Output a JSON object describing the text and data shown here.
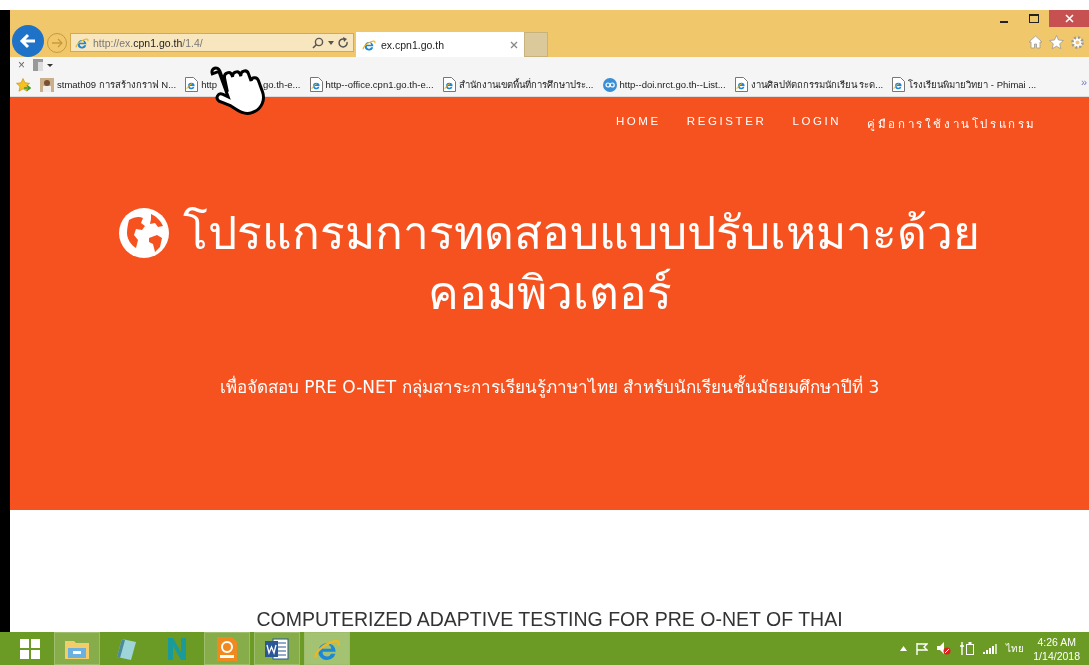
{
  "browser": {
    "command_close": "×",
    "address": "http://ex.**cpn1.go.th**/1.4/",
    "tab_title": "ex.cpn1.go.th",
    "favorites": [
      {
        "kind": "photo",
        "label": "stmath09 การสร้างกราฟ N..."
      },
      {
        "kind": "ie",
        "label": "http",
        "label_end": "go.th-e..."
      },
      {
        "kind": "ie",
        "label": "http--office.cpn1.go.th-e..."
      },
      {
        "kind": "ie",
        "label": "สำนักงานเขตพื้นที่การศึกษาประ..."
      },
      {
        "kind": "doi",
        "label": "http--doi.nrct.go.th--List..."
      },
      {
        "kind": "ie",
        "label": "งานศิลปหัตถกรรมนักเรียน ระด..."
      },
      {
        "kind": "ie",
        "label": "โรงเรียนพิมายวิทยา - Phimai ..."
      }
    ],
    "more": "»"
  },
  "page": {
    "nav": [
      {
        "label": "HOME"
      },
      {
        "label": "REGISTER"
      },
      {
        "label": "LOGIN"
      },
      {
        "label": "คู่มือการใช้งานโปรแกรม"
      }
    ],
    "title_lines": [
      "โปรแกรมการทดสอบแบบปรับเหมาะด้วย",
      "คอมพิวเตอร์"
    ],
    "subtitle": "เพื่อจัดสอบ PRE O-NET กลุ่มสาระการเรียนรู้ภาษาไทย สำหรับนักเรียนชั้นมัธยมศึกษาปีที่ 3",
    "section_heading": "COMPUTERIZED ADAPTIVE TESTING FOR PRE O-NET OF THAI"
  },
  "taskbar": {
    "apps": [
      {
        "kind": "explorer",
        "running": true,
        "selected": false
      },
      {
        "kind": "notepad",
        "running": false,
        "selected": false
      },
      {
        "kind": "n",
        "running": false,
        "selected": false
      },
      {
        "kind": "pdf",
        "running": true,
        "selected": false
      },
      {
        "kind": "word",
        "running": true,
        "selected": false
      },
      {
        "kind": "ie",
        "running": true,
        "selected": true
      }
    ],
    "language": "ไทย",
    "time": "4:26 AM",
    "date": "1/14/2018"
  }
}
